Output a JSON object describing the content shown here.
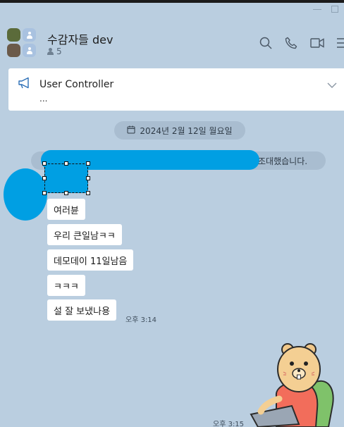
{
  "window": {
    "minimize_label": "",
    "maximize_label": ""
  },
  "header": {
    "title": "수감자들 dev",
    "member_count": "5"
  },
  "notice": {
    "title": "User Controller",
    "subtitle": "..."
  },
  "date_divider": "2024년 2월 12일 월요일",
  "system_message": {
    "suffix": "조대했습니다."
  },
  "messages": [
    {
      "text": "여러뷴"
    },
    {
      "text": "우리 큰일남ㅋㅋ"
    },
    {
      "text": "데모데이 11일남음"
    },
    {
      "text": "ㅋㅋㅋ"
    },
    {
      "text": "설 잘 보냈나용",
      "time": "오후 3:14"
    }
  ],
  "sticker": {
    "time": "오후 3:15"
  },
  "colors": {
    "background": "#bacee0",
    "redaction": "#009fe3"
  }
}
